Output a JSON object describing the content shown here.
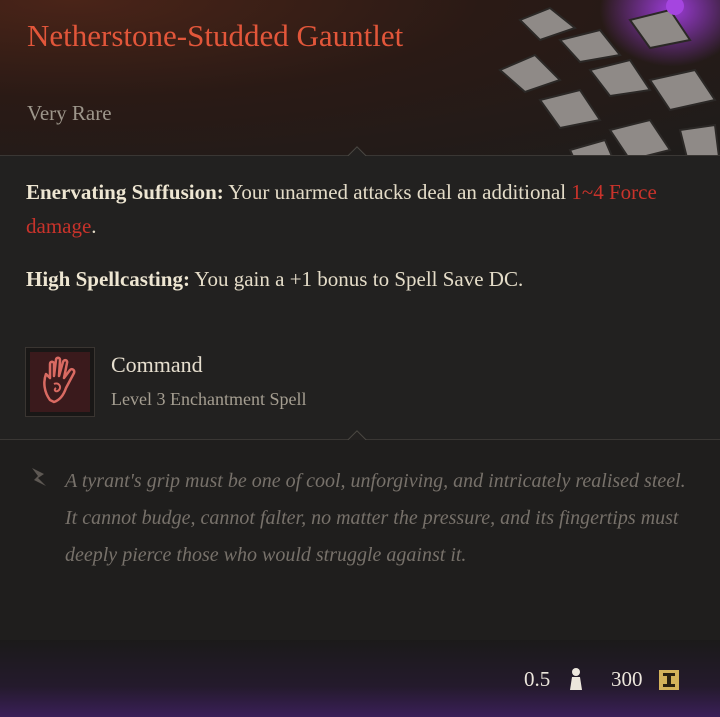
{
  "item": {
    "name": "Netherstone-Studded Gauntlet",
    "rarity": "Very Rare"
  },
  "passives": [
    {
      "name": "Enervating Suffusion:",
      "text_before": " Your unarmed attacks deal an additional ",
      "damage": "1~4 Force damage",
      "text_after": "."
    },
    {
      "name": "High Spellcasting:",
      "text": " You gain a +1 bonus to Spell Save DC."
    }
  ],
  "spell": {
    "name": "Command",
    "subtitle": "Level 3 Enchantment Spell",
    "icon": "open-hand-icon"
  },
  "lore": "A tyrant's grip must be one of cool, unforgiving, and intricately realised steel. It cannot budge, cannot falter, no matter the pressure, and its fingertips must deeply pierce those who would struggle against it.",
  "footer": {
    "weight": "0.5",
    "price": "300"
  },
  "colors": {
    "title": "#e2563a",
    "damage": "#c9332b",
    "footer_glow": "#3a1f58"
  }
}
